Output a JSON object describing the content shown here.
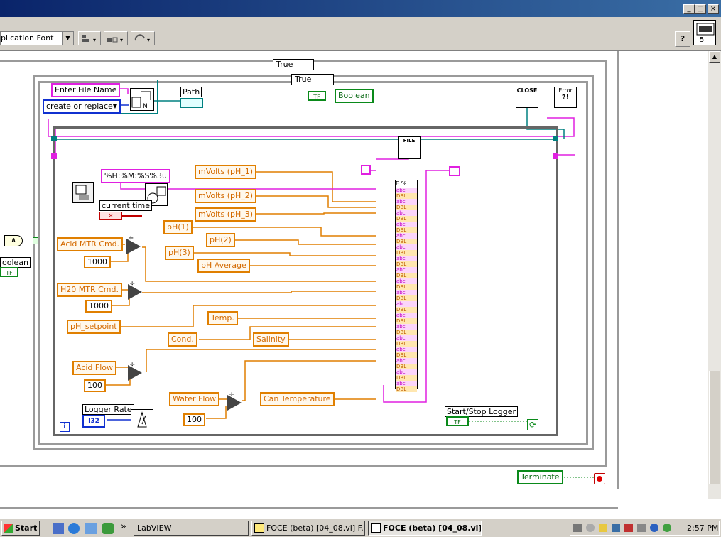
{
  "window": {
    "controls": [
      "_",
      "□",
      "×"
    ]
  },
  "toolbar": {
    "font_ring": "plication Font",
    "help_symbol": "?",
    "connector_number": "5"
  },
  "diagram": {
    "outer_case": "True",
    "inner_case": "True",
    "file_name_control": "Enter File Name",
    "file_op_ring": "create or replace",
    "path_indicator": "Path",
    "boolean_indicator": "Boolean",
    "boolean_left": "oolean",
    "tf_label": "TF",
    "format_string": "%H:%M:%S%3u",
    "current_time": "current time",
    "controls": {
      "mvolts1": "mVolts (pH_1)",
      "mvolts2": "mVolts (pH_2)",
      "mvolts3": "mVolts (pH_3)",
      "ph1": "pH(1)",
      "ph2": "pH(2)",
      "ph3": "pH(3)",
      "ph_avg": "pH Average",
      "acid_mtr": "Acid MTR Cmd.",
      "h2o_mtr": "H20 MTR Cmd.",
      "ph_setpoint": "pH_setpoint",
      "temp": "Temp.",
      "cond": "Cond.",
      "salinity": "Salinity",
      "acid_flow": "Acid Flow",
      "water_flow": "Water Flow",
      "can_temp": "Can Temperature",
      "logger_rate": "Logger Rate",
      "start_stop": "Start/Stop Logger",
      "terminate": "Terminate"
    },
    "constants": {
      "c1000a": "1000",
      "c1000b": "1000",
      "c100a": "100",
      "c100b": "100",
      "i32": "I32",
      "info": "i",
      "and_symbol": "∧",
      "close_label": "CLOSE",
      "error_label": "Error",
      "error_sub": "?!",
      "file_label": "FILE",
      "fmt_symbol": "E %",
      "divide": "÷"
    },
    "format_rows": [
      "abc",
      "DBL",
      "abc",
      "DBL",
      "abc",
      "DBL",
      "abc",
      "DBL",
      "abc",
      "DBL",
      "abc",
      "DBL",
      "abc",
      "DBL",
      "abc",
      "DBL",
      "abc",
      "DBL",
      "abc",
      "DBL",
      "abc",
      "DBL",
      "abc",
      "DBL",
      "abc",
      "DBL",
      "abc",
      "DBL",
      "abc",
      "DBL",
      "abc",
      "DBL",
      "abc",
      "DBL",
      "abc",
      "DBL"
    ]
  },
  "taskbar": {
    "start": "Start",
    "chevron": "»",
    "tasks": [
      "LabVIEW",
      "FOCE (beta) [04_08.vi] F...",
      "FOCE (beta) [04_08.vi]..."
    ],
    "clock": "2:57 PM"
  }
}
